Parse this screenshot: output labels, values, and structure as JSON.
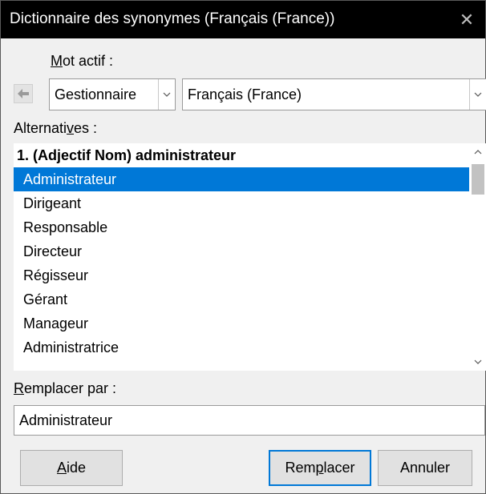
{
  "window": {
    "title": "Dictionnaire des synonymes (Français (France))",
    "close_glyph": "✕"
  },
  "mot_actif": {
    "label_prefix": "",
    "label_mnemonic": "M",
    "label_rest": "ot actif :",
    "back_icon": "left-arrow-icon",
    "word_value": "Gestionnaire",
    "language_value": "Français (France)"
  },
  "alternatives": {
    "label_prefix": "Alternati",
    "label_mnemonic": "v",
    "label_rest": "es :",
    "items": [
      {
        "text": "1. (Adjectif Nom) administrateur",
        "kind": "header"
      },
      {
        "text": "Administrateur",
        "kind": "selected"
      },
      {
        "text": "Dirigeant",
        "kind": "normal"
      },
      {
        "text": "Responsable",
        "kind": "normal"
      },
      {
        "text": "Directeur",
        "kind": "normal"
      },
      {
        "text": "Régisseur",
        "kind": "normal"
      },
      {
        "text": "Gérant",
        "kind": "normal"
      },
      {
        "text": "Manageur",
        "kind": "normal"
      },
      {
        "text": "Administratrice",
        "kind": "normal"
      }
    ]
  },
  "remplacer": {
    "label_prefix": "",
    "label_mnemonic": "R",
    "label_rest": "emplacer par :",
    "value": "Administrateur"
  },
  "buttons": {
    "help": {
      "prefix": "",
      "mnemonic": "A",
      "rest": "ide"
    },
    "replace": {
      "prefix": "Rem",
      "mnemonic": "p",
      "rest": "lacer"
    },
    "cancel": {
      "label": "Annuler"
    }
  },
  "colors": {
    "title_bar": "#000000",
    "selection": "#0078d7",
    "dialog_bg": "#f0f0f0"
  }
}
